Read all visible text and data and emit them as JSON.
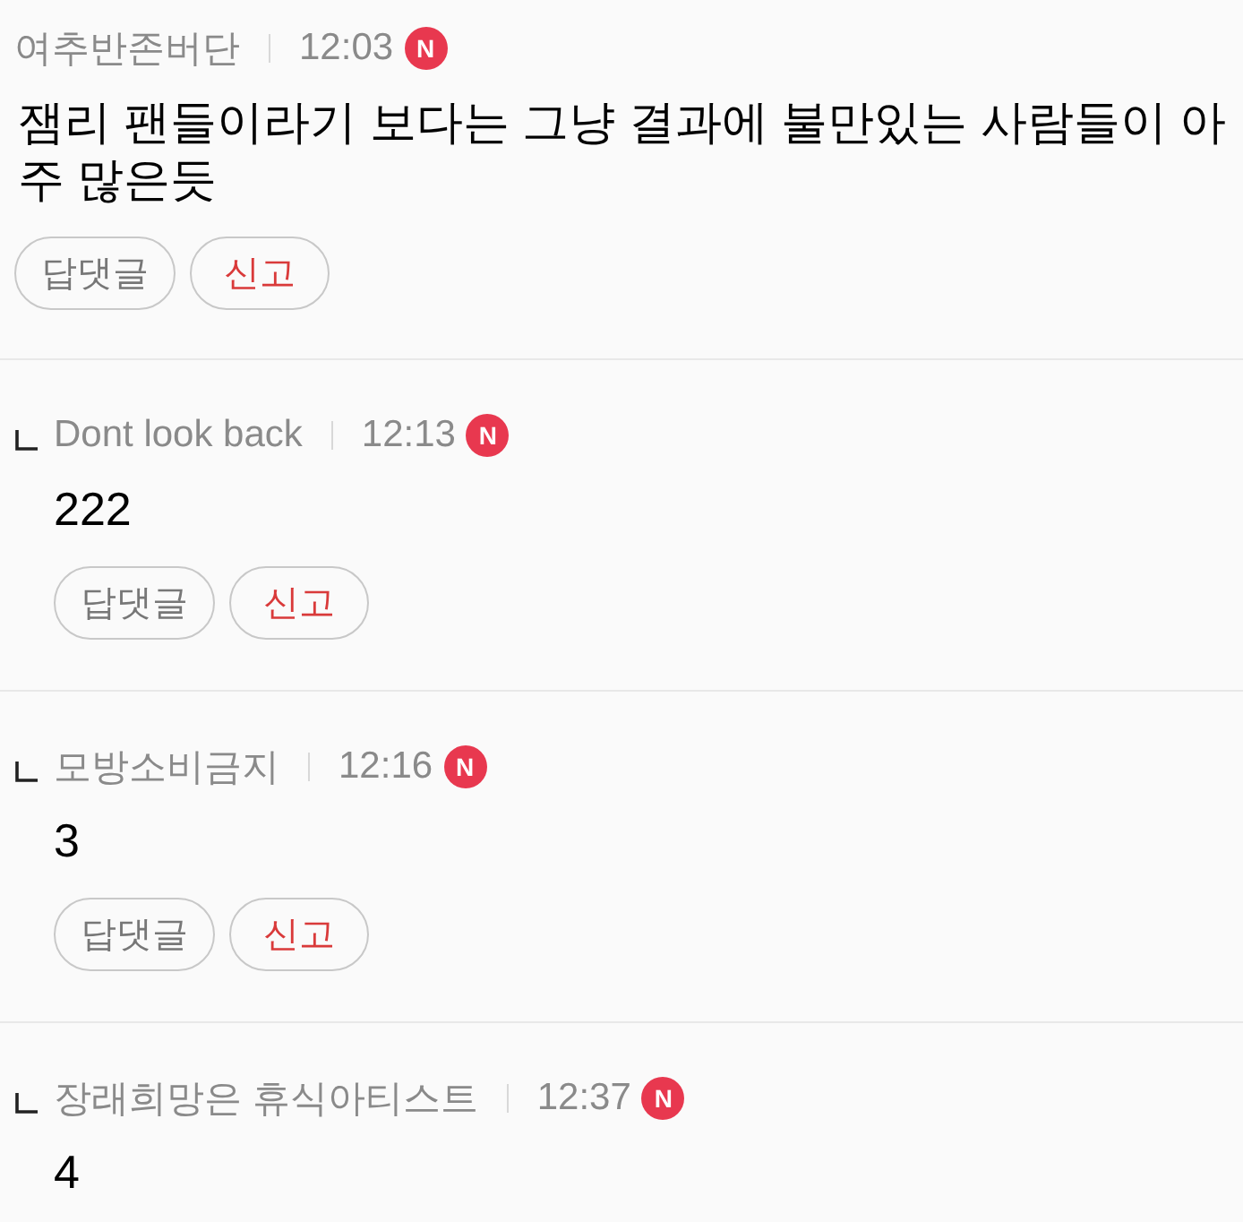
{
  "comments": [
    {
      "reply": false,
      "author": "여추반존버단",
      "time": "12:03",
      "badge": "N",
      "body": "잼리 팬들이라기 보다는 그냥 결과에 불만있는 사람들이 아주 많은듯",
      "buttons": [
        {
          "label": "답댓글",
          "kind": "reply"
        },
        {
          "label": "신고",
          "kind": "report"
        }
      ]
    },
    {
      "reply": true,
      "author": "Dont look back",
      "time": "12:13",
      "badge": "N",
      "body": "222",
      "buttons": [
        {
          "label": "답댓글",
          "kind": "reply"
        },
        {
          "label": "신고",
          "kind": "report"
        }
      ]
    },
    {
      "reply": true,
      "author": "모방소비금지",
      "time": "12:16",
      "badge": "N",
      "body": "3",
      "buttons": [
        {
          "label": "답댓글",
          "kind": "reply"
        },
        {
          "label": "신고",
          "kind": "report"
        }
      ]
    },
    {
      "reply": true,
      "author": "장래희망은 휴식아티스트",
      "time": "12:37",
      "badge": "N",
      "body": "4"
    }
  ]
}
